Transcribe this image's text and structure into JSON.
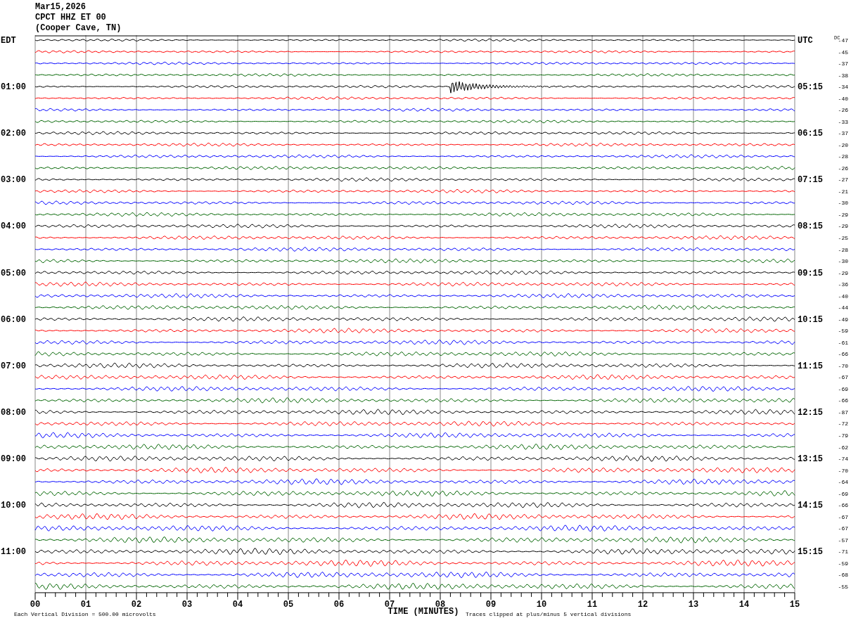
{
  "header": {
    "date": "Mar15,2026",
    "station": "CPCT HHZ ET 00",
    "location": "(Cooper Cave, TN)"
  },
  "dc_title": "DC",
  "hours": [
    {
      "local": "EDT",
      "utc": "UTC",
      "traces": [
        {
          "color": "#000000",
          "dc": "-47"
        },
        {
          "color": "#ff0000",
          "dc": "-45"
        },
        {
          "color": "#0000ff",
          "dc": "-37"
        },
        {
          "color": "#006400",
          "dc": "-38"
        }
      ]
    },
    {
      "local": "01:00",
      "utc": "05:15",
      "traces": [
        {
          "color": "#000000",
          "dc": "-34"
        },
        {
          "color": "#ff0000",
          "dc": "-40"
        },
        {
          "color": "#0000ff",
          "dc": "-26"
        },
        {
          "color": "#006400",
          "dc": "-33"
        }
      ]
    },
    {
      "local": "02:00",
      "utc": "06:15",
      "traces": [
        {
          "color": "#000000",
          "dc": "-37"
        },
        {
          "color": "#ff0000",
          "dc": "-20"
        },
        {
          "color": "#0000ff",
          "dc": "-28"
        },
        {
          "color": "#006400",
          "dc": "-26"
        }
      ]
    },
    {
      "local": "03:00",
      "utc": "07:15",
      "traces": [
        {
          "color": "#000000",
          "dc": "-27"
        },
        {
          "color": "#ff0000",
          "dc": "-21"
        },
        {
          "color": "#0000ff",
          "dc": "-30"
        },
        {
          "color": "#006400",
          "dc": "-29"
        }
      ]
    },
    {
      "local": "04:00",
      "utc": "08:15",
      "traces": [
        {
          "color": "#000000",
          "dc": "-29"
        },
        {
          "color": "#ff0000",
          "dc": "-25"
        },
        {
          "color": "#0000ff",
          "dc": "-28"
        },
        {
          "color": "#006400",
          "dc": "-30"
        }
      ]
    },
    {
      "local": "05:00",
      "utc": "09:15",
      "traces": [
        {
          "color": "#000000",
          "dc": "-29"
        },
        {
          "color": "#ff0000",
          "dc": "-36"
        },
        {
          "color": "#0000ff",
          "dc": "-40"
        },
        {
          "color": "#006400",
          "dc": "-44"
        }
      ]
    },
    {
      "local": "06:00",
      "utc": "10:15",
      "traces": [
        {
          "color": "#000000",
          "dc": "-49"
        },
        {
          "color": "#ff0000",
          "dc": "-59"
        },
        {
          "color": "#0000ff",
          "dc": "-61"
        },
        {
          "color": "#006400",
          "dc": "-66"
        }
      ]
    },
    {
      "local": "07:00",
      "utc": "11:15",
      "traces": [
        {
          "color": "#000000",
          "dc": "-70"
        },
        {
          "color": "#ff0000",
          "dc": "-67"
        },
        {
          "color": "#0000ff",
          "dc": "-69"
        },
        {
          "color": "#006400",
          "dc": "-66"
        }
      ]
    },
    {
      "local": "08:00",
      "utc": "12:15",
      "traces": [
        {
          "color": "#000000",
          "dc": "-87"
        },
        {
          "color": "#ff0000",
          "dc": "-72"
        },
        {
          "color": "#0000ff",
          "dc": "-79"
        },
        {
          "color": "#006400",
          "dc": "-62"
        }
      ]
    },
    {
      "local": "09:00",
      "utc": "13:15",
      "traces": [
        {
          "color": "#000000",
          "dc": "-74"
        },
        {
          "color": "#ff0000",
          "dc": "-70"
        },
        {
          "color": "#0000ff",
          "dc": "-64"
        },
        {
          "color": "#006400",
          "dc": "-69"
        }
      ]
    },
    {
      "local": "10:00",
      "utc": "14:15",
      "traces": [
        {
          "color": "#000000",
          "dc": "-66"
        },
        {
          "color": "#ff0000",
          "dc": "-67"
        },
        {
          "color": "#0000ff",
          "dc": "-67"
        },
        {
          "color": "#006400",
          "dc": "-57"
        }
      ]
    },
    {
      "local": "11:00",
      "utc": "15:15",
      "traces": [
        {
          "color": "#000000",
          "dc": "-71"
        },
        {
          "color": "#ff0000",
          "dc": "-59"
        },
        {
          "color": "#0000ff",
          "dc": "-68"
        },
        {
          "color": "#006400",
          "dc": "-55"
        }
      ]
    }
  ],
  "x_ticks": [
    "00",
    "01",
    "02",
    "03",
    "04",
    "05",
    "06",
    "07",
    "08",
    "09",
    "10",
    "11",
    "12",
    "13",
    "14",
    "15"
  ],
  "x_title": "TIME (MINUTES)",
  "scale_note": "Each Vertical Division =  500.00 microvolts",
  "clip_note": "Traces clipped at plus/minus 5 vertical divisions"
}
